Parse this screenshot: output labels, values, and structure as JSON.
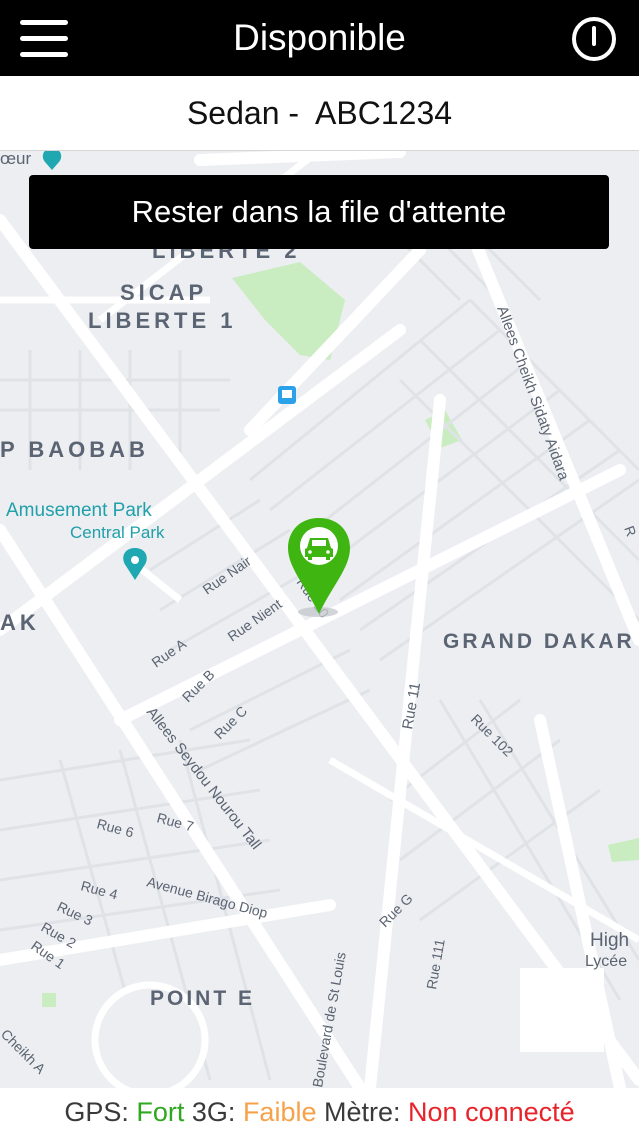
{
  "header": {
    "title": "Disponible",
    "menu_icon": "hamburger-menu-icon",
    "power_icon": "power-icon"
  },
  "vehicle": {
    "label": "Sedan -  ABC1234"
  },
  "queue_button": {
    "label": "Rester dans la file d'attente"
  },
  "map": {
    "areas": [
      "SICAP",
      "LIBERTE 1",
      "LIBERTE 2",
      "P BAOBAB",
      "GRAND DAKAR",
      "POINT E",
      "AK"
    ],
    "places": [
      "Amusement Park",
      "Central Park",
      "High",
      "Lycée",
      "œur"
    ],
    "streets": {
      "cheikh_sidaty": "Allees Cheikh Sidaty Aidara",
      "seydou": "Allees Seydou Nourou Tall",
      "rue_nair": "Rue Nair",
      "rue_nient": "Rue Nient",
      "rue_a": "Rue A",
      "rue_b": "Rue B",
      "rue_c": "Rue C",
      "rue_10": "Rue 10",
      "rue_11": "Rue 11",
      "rue_102": "Rue 102",
      "rue_111": "Rue 111",
      "rue_g": "Rue G",
      "rue_6": "Rue 6",
      "rue_7": "Rue 7",
      "rue_4": "Rue 4",
      "rue_3": "Rue 3",
      "rue_2": "Rue 2",
      "rue_1": "Rue 1",
      "birago": "Avenue Birago Diop",
      "st_louis": "Boulevard de St Louis",
      "cheikh_a": "Cheikh A",
      "r_edge": "R"
    },
    "marker_icon": "car-location-pin-icon",
    "marker_color": "#3fb512"
  },
  "status": {
    "gps_label": "GPS:",
    "gps_value": "Fort",
    "net_label": "3G:",
    "net_value": "Faible",
    "meter_label": "Mètre:",
    "meter_value": "Non connecté",
    "colors": {
      "good": "#2ea81f",
      "weak": "#f5a24a",
      "bad": "#e8232a"
    }
  }
}
